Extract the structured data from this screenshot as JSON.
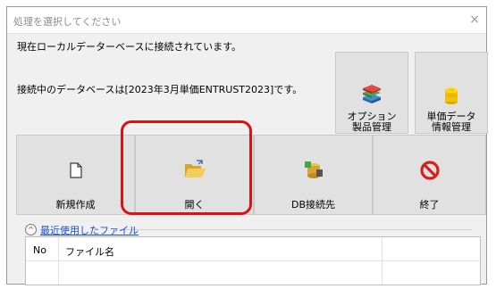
{
  "window": {
    "title": "処理を選択してください",
    "close": "×"
  },
  "status": {
    "connected": "現在ローカルデーターベースに接続されています。",
    "database": "接続中のデータベースは[2023年3月単価ENTRUST2023]です。"
  },
  "top_buttons": [
    {
      "line1": "オプション",
      "line2": "製品管理",
      "icon": "books-icon"
    },
    {
      "line1": "単価データ",
      "line2": "情報管理",
      "icon": "coins-icon"
    }
  ],
  "main_buttons": [
    {
      "label": "新規作成",
      "icon": "new-document-icon"
    },
    {
      "label": "開く",
      "icon": "open-folder-icon"
    },
    {
      "label": "DB接続先",
      "icon": "database-connect-icon"
    },
    {
      "label": "終了",
      "icon": "prohibited-icon"
    }
  ],
  "recent": {
    "toggle": "^",
    "link": "最近使用したファイル",
    "columns": [
      "No",
      "ファイル名"
    ]
  },
  "colors": {
    "highlight": "#e01010",
    "link": "#1a4fd6"
  }
}
